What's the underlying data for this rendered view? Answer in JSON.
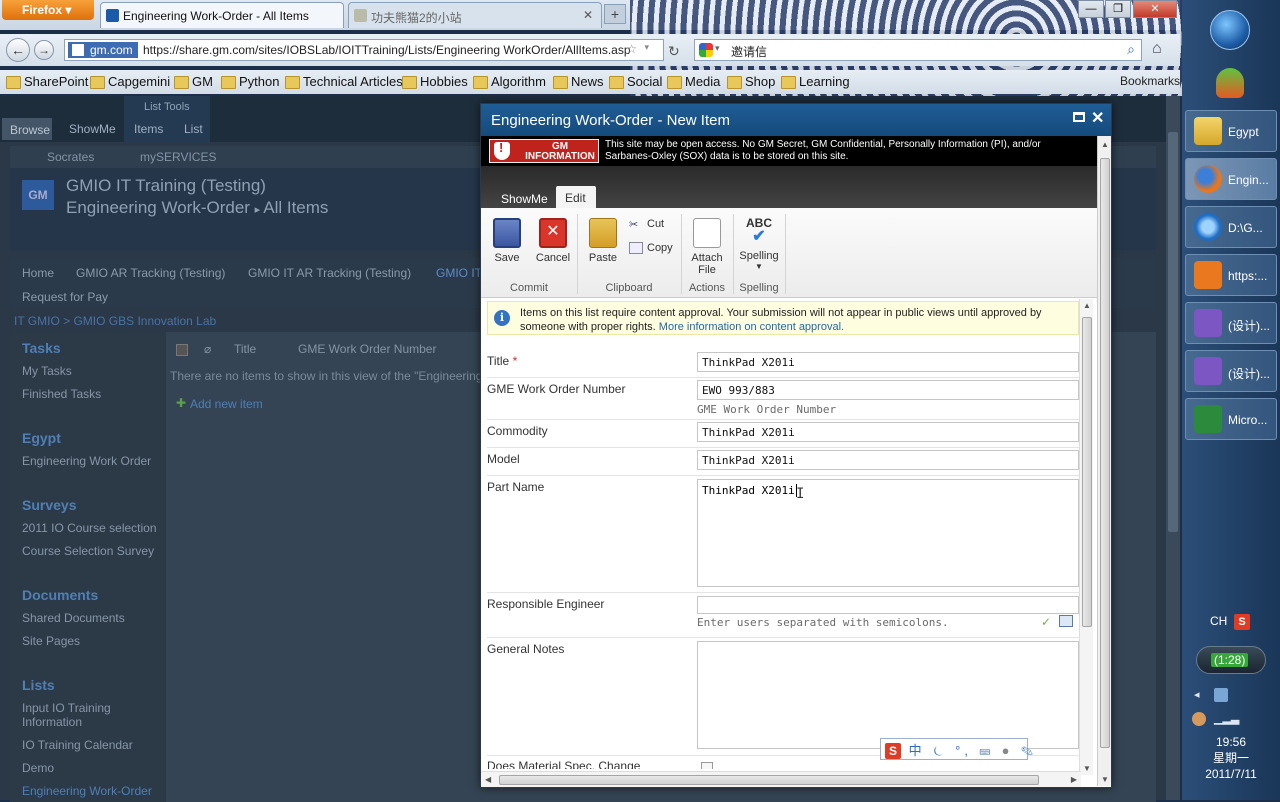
{
  "browser": {
    "menu_button": "Firefox",
    "tabs": [
      {
        "label": "Engineering Work-Order - All Items"
      },
      {
        "label": "功夫熊猫2的小站"
      }
    ],
    "url_identity": "gm.com",
    "url": "https://share.gm.com/sites/IOBSLab/IOITTraining/Lists/Engineering WorkOrder/AllItems.asp",
    "search_text": "邀请信",
    "bookmarks": [
      "SharePoint",
      "Capgemini",
      "GM",
      "Python",
      "Technical Articles",
      "Hobbies",
      "Algorithm",
      "News",
      "Social",
      "Media",
      "Shop",
      "Learning"
    ],
    "bookmarks_menu": "Bookmarks"
  },
  "sharepoint": {
    "ribbon_tabs": {
      "browse": "Browse",
      "showme": "ShowMe",
      "items": "Items",
      "list": "List",
      "list_tools": "List Tools"
    },
    "sub_links": [
      "Socrates",
      "mySERVICES"
    ],
    "logo": "GM",
    "site_title": "GMIO IT Training (Testing)",
    "list_title": "Engineering Work-Order",
    "view_title": "All Items",
    "top_nav": [
      "Home",
      "GMIO AR Tracking (Testing)",
      "GMIO IT AR Tracking (Testing)",
      "GMIO IT",
      "Request for Pay"
    ],
    "breadcrumb": "IT GMIO > GMIO GBS Innovation Lab",
    "quick_launch": [
      {
        "heading": "Tasks",
        "items": [
          "My Tasks",
          "Finished Tasks"
        ]
      },
      {
        "heading": "Egypt",
        "items": [
          "Engineering Work Order"
        ]
      },
      {
        "heading": "Surveys",
        "items": [
          "2011 IO Course selection",
          "Course Selection Survey"
        ]
      },
      {
        "heading": "Documents",
        "items": [
          "Shared Documents",
          "Site Pages"
        ]
      },
      {
        "heading": "Lists",
        "items": [
          "Input IO Training Information",
          "IO Training Calendar",
          "Demo",
          "Engineering Work-Order"
        ]
      }
    ],
    "list_columns": [
      "Title",
      "GME Work Order Number"
    ],
    "empty_message": "There are no items to show in this view of the \"Engineering Work",
    "add_new_item": "Add new item"
  },
  "dialog": {
    "title": "Engineering Work-Order - New Item",
    "banner_badge_line1": "GM",
    "banner_badge_line2": "INFORMATION",
    "banner_text": "This site may be open access. No GM Secret, GM Confidential, Personally Information (PI), and/or Sarbanes-Oxley (SOX) data is to be stored on this site.",
    "ribbon_tabs": {
      "showme": "ShowMe",
      "edit": "Edit"
    },
    "ribbon": {
      "save": "Save",
      "cancel": "Cancel",
      "paste": "Paste",
      "cut": "Cut",
      "copy": "Copy",
      "attach_line1": "Attach",
      "attach_line2": "File",
      "spelling": "Spelling",
      "spelling_icon_text": "ABC",
      "groups": {
        "commit": "Commit",
        "clipboard": "Clipboard",
        "actions": "Actions",
        "spelling": "Spelling"
      }
    },
    "notice": "Items on this list require content approval. Your submission will not appear in public views until approved by someone with proper rights.",
    "notice_link": "More information on content approval.",
    "fields": {
      "title": {
        "label": "Title",
        "required_mark": "*",
        "value": "ThinkPad X201i"
      },
      "gme_number": {
        "label": "GME Work Order Number",
        "value": "EWO 993/883",
        "description": "GME Work Order Number"
      },
      "commodity": {
        "label": "Commodity",
        "value": "ThinkPad X201i"
      },
      "model": {
        "label": "Model",
        "value": "ThinkPad X201i"
      },
      "part_name": {
        "label": "Part Name",
        "value": "ThinkPad X201i"
      },
      "responsible_engineer": {
        "label": "Responsible Engineer",
        "value": "",
        "description": "Enter users separated with semicolons."
      },
      "general_notes": {
        "label": "General Notes",
        "value": ""
      },
      "material_spec": {
        "label": "Does Material Spec. Change"
      }
    }
  },
  "ime_bar": {
    "logo": "S",
    "chars": "中 ⏾ °,"
  },
  "taskbar": {
    "tasks": [
      {
        "label": "Egypt",
        "icon": "folder-icon"
      },
      {
        "label": "Engin...",
        "icon": "firefox-icon"
      },
      {
        "label": "D:\\G...",
        "icon": "ie-icon"
      },
      {
        "label": "https:...",
        "icon": "tools-icon"
      },
      {
        "label": "(设计)...",
        "icon": "infopath-icon"
      },
      {
        "label": "(设计)...",
        "icon": "infopath-icon"
      },
      {
        "label": "Micro...",
        "icon": "excel-icon"
      }
    ],
    "language": "CH",
    "ime_logo": "S",
    "battery_time": "(1:28)",
    "time": "19:56",
    "weekday": "星期一",
    "date": "2011/7/11"
  },
  "colors": {
    "dialog_title": "#1a5488",
    "gm_red": "#c0221c",
    "sp_link": "#4f7fb5"
  }
}
